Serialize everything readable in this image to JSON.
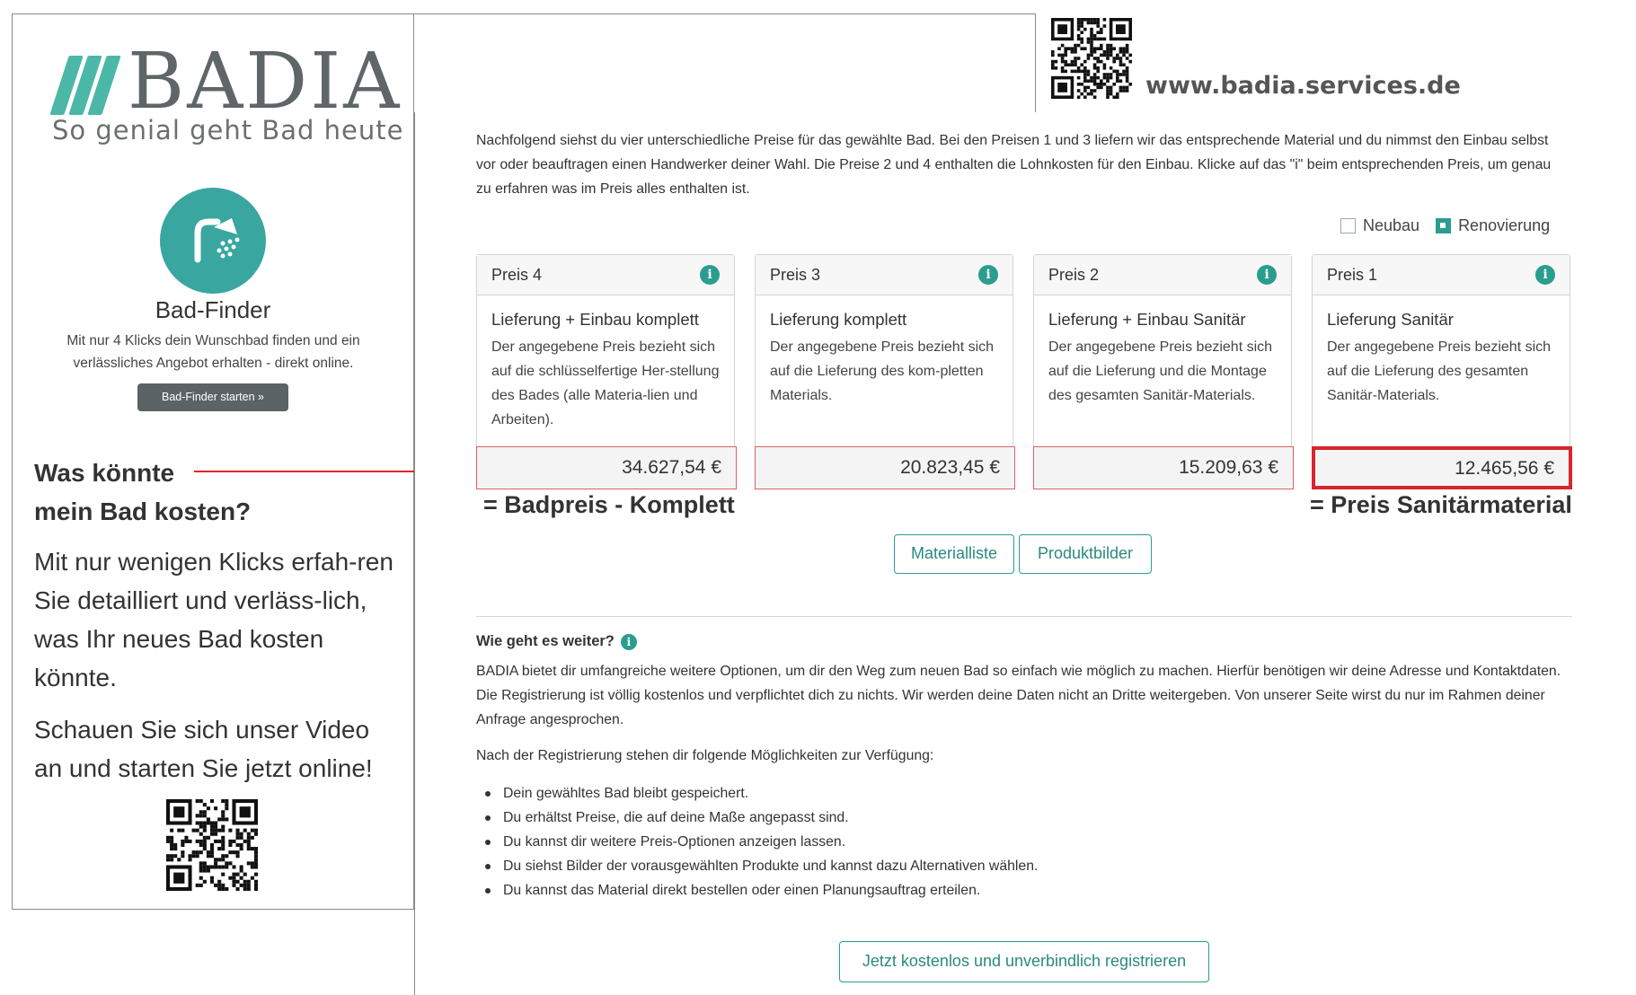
{
  "flyer": {
    "brand": "BADIA",
    "tagline": "So genial geht Bad heute",
    "bad_finder": {
      "icon": "shower-icon",
      "title": "Bad-Finder",
      "description": "Mit nur 4 Klicks dein Wunschbad finden und ein verlässliches Angebot erhalten - direkt online.",
      "button_label": "Bad-Finder starten »"
    },
    "question_line1": "Was könnte",
    "question_line2": "mein Bad kosten?",
    "paragraph1": "Mit nur wenigen Klicks erfah-ren Sie detailliert und verläss-lich, was Ihr neues Bad kosten könnte.",
    "paragraph2": "Schauen Sie sich unser Video an und starten Sie jetzt online!",
    "website": "www.badia.services.de"
  },
  "page": {
    "intro": "Nachfolgend siehst du vier unterschiedliche Preise für das gewählte Bad. Bei den Preisen 1 und 3 liefern wir das entsprechende Material und du nimmst den Einbau selbst vor oder beauftragen einen Handwerker deiner Wahl. Die Preise 2 und 4 enthalten die Lohnkosten für den Einbau. Klicke auf das \"i\" beim entsprechenden Preis, um genau zu erfahren was im Preis alles enthalten ist.",
    "type_options": [
      {
        "label": "Neubau",
        "checked": false
      },
      {
        "label": "Renovierung",
        "checked": true
      }
    ],
    "cards": [
      {
        "header": "Preis 4",
        "title": "Lieferung + Einbau komplett",
        "text": "Der angegebene Preis bezieht sich auf die schlüsselfertige Her-stellung des Bades (alle Materia-lien und Arbeiten).",
        "price": "34.627,54 €"
      },
      {
        "header": "Preis 3",
        "title": "Lieferung komplett",
        "text": "Der angegebene Preis bezieht sich auf die Lieferung des kom-pletten Materials.",
        "price": "20.823,45 €"
      },
      {
        "header": "Preis 2",
        "title": "Lieferung + Einbau Sanitär",
        "text": "Der angegebene Preis bezieht sich auf die Lieferung und die Montage des gesamten Sanitär-Materials.",
        "price": "15.209,63 €"
      },
      {
        "header": "Preis 1",
        "title": "Lieferung Sanitär",
        "text": "Der angegebene Preis bezieht sich auf die Lieferung des gesamten Sanitär-Materials.",
        "price": "12.465,56 €"
      }
    ],
    "annotations": {
      "left": "= Badpreis - Komplett",
      "right": "= Preis Sanitärmaterial"
    },
    "buttons": {
      "materialliste": "Materialliste",
      "produktbilder": "Produktbilder",
      "register": "Jetzt kostenlos und unverbindlich registrieren"
    },
    "next": {
      "title": "Wie geht es weiter?",
      "description": "BADIA bietet dir umfangreiche weitere Optionen, um dir den Weg zum neuen Bad so einfach wie möglich zu machen. Hierfür benötigen wir deine Adresse und Kontaktdaten. Die Registrierung ist völlig kostenlos und verpflichtet dich zu nichts. Wir werden deine Daten nicht an Dritte weitergeben. Von unserer Seite wirst du nur im Rahmen deiner Anfrage angesprochen.",
      "after_registration": "Nach der Registrierung stehen dir folgende Möglichkeiten zur Verfügung:",
      "items": [
        "Dein gewähltes Bad bleibt gespeichert.",
        "Du erhältst Preise, die auf deine Maße angepasst sind.",
        "Du kannst dir weitere Preis-Optionen anzeigen lassen.",
        "Du siehst Bilder der vorausgewählten Produkte und kannst dazu Alternativen wählen.",
        "Du kannst das Material direkt bestellen oder einen Planungsauftrag erteilen."
      ]
    }
  },
  "colors": {
    "brand_teal": "#4bb7a7",
    "accent_teal": "#2a9d8f",
    "highlight_red": "#d7262c",
    "finder_button": "#5c6366"
  }
}
